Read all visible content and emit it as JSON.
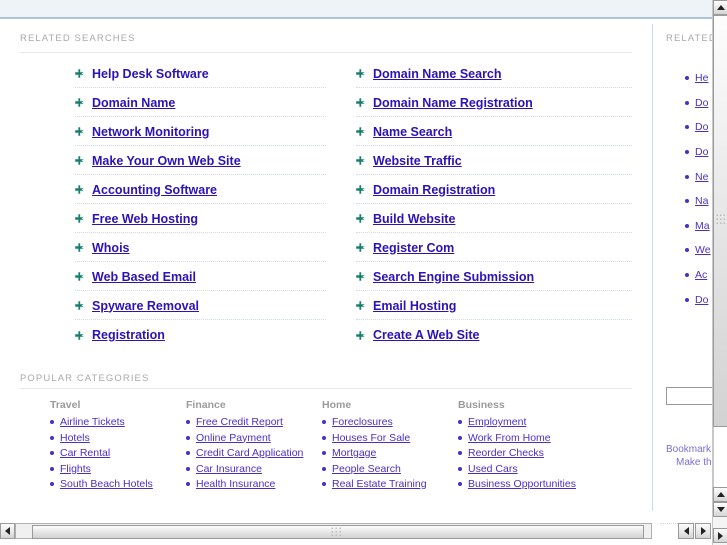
{
  "sections": {
    "related_searches_label": "RELATED SEARCHES",
    "popular_categories_label": "POPULAR CATEGORIES"
  },
  "colors": {
    "link_blue": "#2b13b5",
    "category_link": "#4b2fc4",
    "section_label_gray": "#a9a9a9",
    "header_band": "#eef3f8",
    "header_border": "#a8c4e0",
    "divider": "#ccd8ef",
    "bullet_arrow_green": "#17806d"
  },
  "related_searches": {
    "left_column": [
      {
        "label": "Help Desk Software",
        "icon": "plus-arrow-icon",
        "underlined": false
      },
      {
        "label": "Domain Name",
        "icon": "plus-arrow-icon",
        "underlined": true
      },
      {
        "label": "Network Monitoring",
        "icon": "plus-arrow-icon",
        "underlined": true
      },
      {
        "label": "Make Your Own Web Site",
        "icon": "plus-arrow-icon",
        "underlined": true
      },
      {
        "label": "Accounting Software",
        "icon": "plus-arrow-icon",
        "underlined": true
      },
      {
        "label": "Free Web Hosting",
        "icon": "plus-arrow-icon",
        "underlined": true
      },
      {
        "label": "Whois",
        "icon": "plus-arrow-icon",
        "underlined": true
      },
      {
        "label": "Web Based Email",
        "icon": "plus-arrow-icon",
        "underlined": true
      },
      {
        "label": "Spyware Removal",
        "icon": "plus-arrow-icon",
        "underlined": true
      },
      {
        "label": "Registration",
        "icon": "plus-arrow-icon",
        "underlined": true
      }
    ],
    "right_column": [
      {
        "label": "Domain Name Search",
        "icon": "plus-arrow-icon",
        "underlined": true
      },
      {
        "label": "Domain Name Registration",
        "icon": "plus-arrow-icon",
        "underlined": true
      },
      {
        "label": "Name Search",
        "icon": "plus-arrow-icon",
        "underlined": true
      },
      {
        "label": "Website Traffic",
        "icon": "plus-arrow-icon",
        "underlined": true
      },
      {
        "label": "Domain Registration",
        "icon": "plus-arrow-icon",
        "underlined": true
      },
      {
        "label": "Build Website",
        "icon": "plus-arrow-icon",
        "underlined": true
      },
      {
        "label": "Register Com",
        "icon": "plus-arrow-icon",
        "underlined": true
      },
      {
        "label": "Search Engine Submission",
        "icon": "plus-arrow-icon",
        "underlined": true
      },
      {
        "label": "Email Hosting",
        "icon": "plus-arrow-icon",
        "underlined": true
      },
      {
        "label": "Create A Web Site",
        "icon": "plus-arrow-icon",
        "underlined": true
      }
    ]
  },
  "popular_categories": [
    {
      "heading": "Travel",
      "links": [
        "Airline Tickets",
        "Hotels",
        "Car Rental",
        "Flights",
        "South Beach Hotels"
      ]
    },
    {
      "heading": "Finance",
      "links": [
        "Free Credit Report",
        "Online Payment",
        "Credit Card Application",
        "Car Insurance",
        "Health Insurance"
      ]
    },
    {
      "heading": "Home",
      "links": [
        "Foreclosures",
        "Houses For Sale",
        "Mortgage",
        "People Search",
        "Real Estate Training"
      ]
    },
    {
      "heading": "Business",
      "links": [
        "Employment",
        "Work From Home",
        "Reorder Checks",
        "Used Cars",
        "Business Opportunities"
      ]
    }
  ],
  "sidebar": {
    "label": "RELATED",
    "items": [
      "He",
      "Do",
      "Do",
      "Do",
      "Ne",
      "Na",
      "Ma",
      "We",
      "Ac",
      "Do"
    ],
    "search_input_value": "",
    "footer_line1": "Bookmark",
    "footer_line2": "Make this"
  },
  "scrollbars": {
    "vertical_up_icon": "triangle-up-icon",
    "vertical_down_icon": "triangle-down-icon",
    "horizontal_left_icon": "triangle-left-icon",
    "horizontal_right_icon": "triangle-right-icon"
  }
}
